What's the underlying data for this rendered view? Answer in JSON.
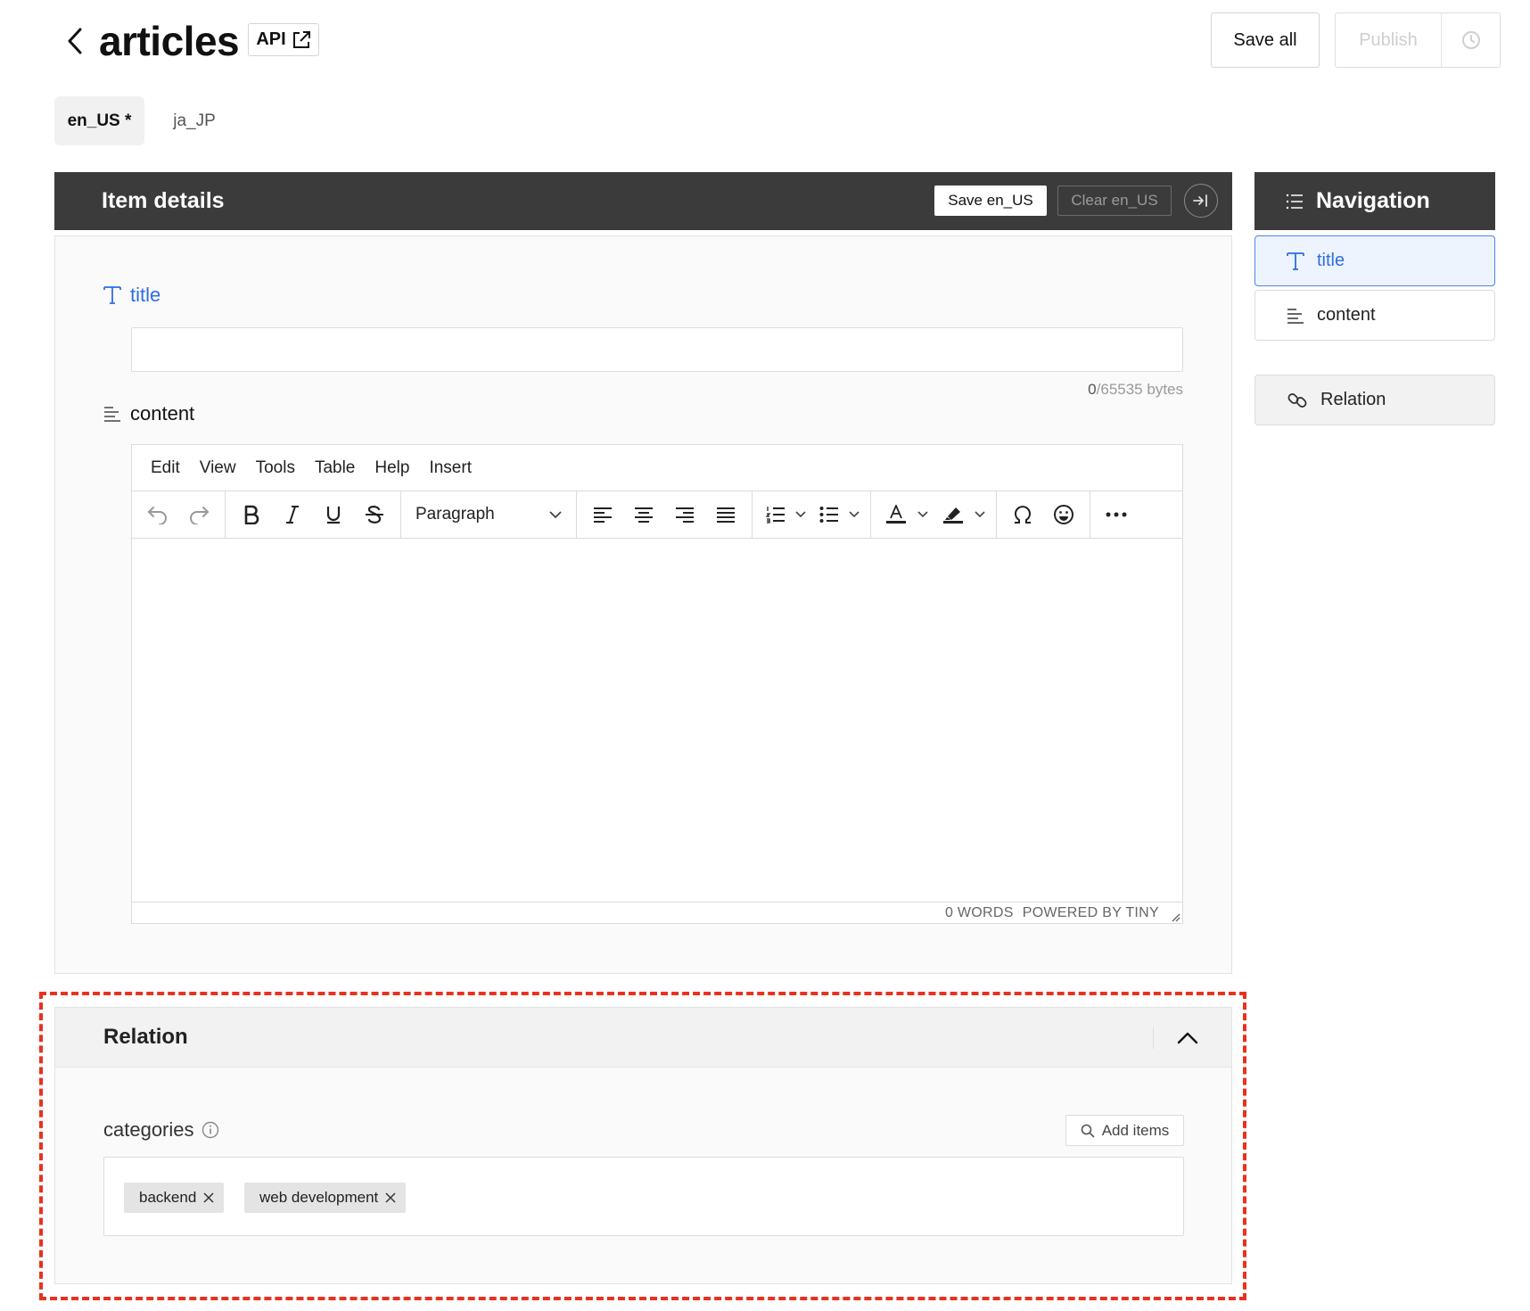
{
  "header": {
    "title": "articles",
    "api_label": "API",
    "save_all_label": "Save all",
    "publish_label": "Publish"
  },
  "locales": {
    "active": "en_US *",
    "inactive": "ja_JP"
  },
  "item_details": {
    "heading": "Item details",
    "save_label": "Save en_US",
    "clear_label": "Clear en_US"
  },
  "fields": {
    "title": {
      "label": "title",
      "value": "",
      "bytes_used": "0",
      "bytes_limit": "/65535 bytes"
    },
    "content": {
      "label": "content"
    }
  },
  "editor": {
    "menu": [
      "Edit",
      "View",
      "Tools",
      "Table",
      "Help",
      "Insert"
    ],
    "block_format": "Paragraph",
    "word_count": "0 WORDS",
    "powered_by": "POWERED BY TINY"
  },
  "relation": {
    "heading": "Relation",
    "field_label": "categories",
    "add_items_label": "Add items",
    "tags": [
      "backend",
      "web development"
    ]
  },
  "navigation": {
    "heading": "Navigation",
    "items": [
      "title",
      "content",
      "Relation"
    ]
  },
  "colors": {
    "accent": "#2d6ee0",
    "header_dark": "#3b3b3b",
    "highlight_outline": "#e8321f"
  }
}
